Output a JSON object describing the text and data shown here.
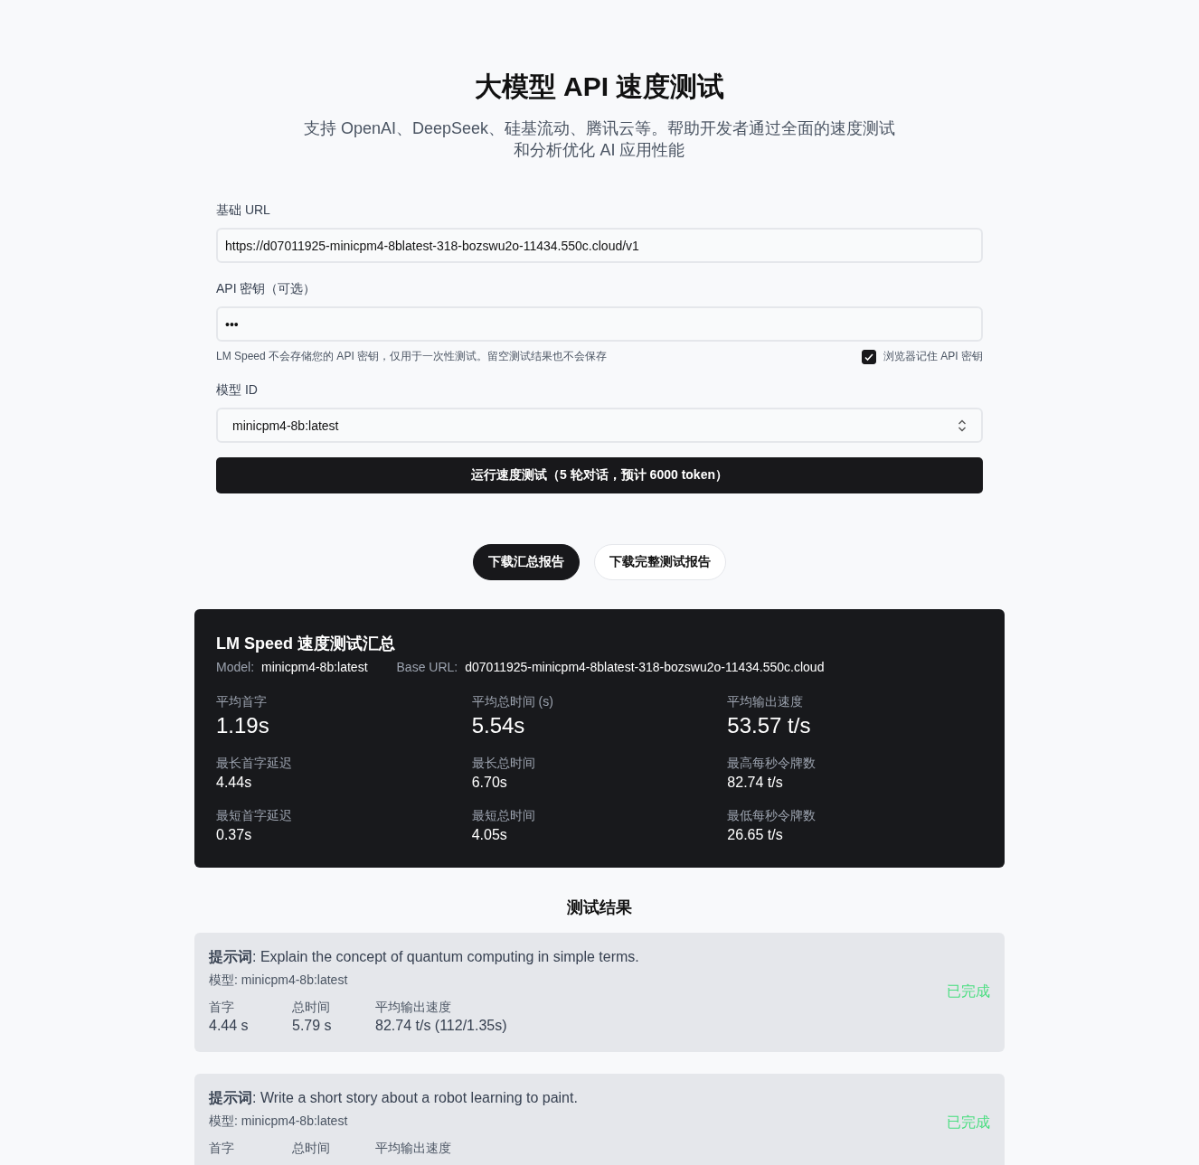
{
  "header": {
    "title": "大模型 API 速度测试",
    "subtitle_lines": [
      "支持 OpenAI、DeepSeek、硅基流动、腾讯云等。帮助开发者通过全面的速度测试",
      "和分析优化 AI 应用性能"
    ]
  },
  "form": {
    "base_url": {
      "label": "基础 URL",
      "value": "https://d07011925-minicpm4-8blatest-318-bozswu2o-11434.550c.cloud/v1"
    },
    "api_key": {
      "label": "API 密钥（可选）",
      "value": "•••",
      "hint": "LM Speed 不会存储您的 API 密钥，仅用于一次性测试。留空测试结果也不会保存",
      "remember": {
        "label": "浏览器记住 API 密钥",
        "checked": true
      }
    },
    "model": {
      "label": "模型 ID",
      "value": "minicpm4-8b:latest"
    },
    "run_button": "运行速度测试（5 轮对话，预计 6000 token）"
  },
  "downloads": [
    {
      "label": "下载汇总报告",
      "selected": true
    },
    {
      "label": "下载完整测试报告",
      "selected": false
    }
  ],
  "summary": {
    "title": "LM Speed 速度测试汇总",
    "meta": [
      {
        "label": "Model:",
        "value": "minicpm4-8b:latest"
      },
      {
        "label": "Base URL:",
        "value": "d07011925-minicpm4-8blatest-318-bozswu2o-11434.550c.cloud"
      }
    ],
    "stats": [
      {
        "label": "平均首字",
        "value": "1.19s",
        "kind": "main"
      },
      {
        "label": "平均总时间 (s)",
        "value": "5.54s",
        "kind": "main"
      },
      {
        "label": "平均输出速度",
        "value": "53.57 t/s",
        "kind": "main"
      },
      {
        "label": "最长首字延迟",
        "value": "4.44s",
        "kind": "minor"
      },
      {
        "label": "最长总时间",
        "value": "6.70s",
        "kind": "minor"
      },
      {
        "label": "最高每秒令牌数",
        "value": "82.74 t/s",
        "kind": "minor"
      },
      {
        "label": "最短首字延迟",
        "value": "0.37s",
        "kind": "minor"
      },
      {
        "label": "最短总时间",
        "value": "4.05s",
        "kind": "minor"
      },
      {
        "label": "最低每秒令牌数",
        "value": "26.65 t/s",
        "kind": "minor"
      }
    ]
  },
  "results": {
    "title": "测试结果",
    "items": [
      {
        "prompt": "**提示词**: Explain the concept of quantum computing in simple terms.",
        "model": "模型: minicpm4-8b:latest",
        "status_label": "已完成",
        "metrics": [
          {
            "label": "首字",
            "value": "4.44 s"
          },
          {
            "label": "总时间",
            "value": "5.79 s"
          },
          {
            "label": "平均输出速度",
            "value": "82.74 t/s (112/1.35s)"
          }
        ]
      },
      {
        "prompt": "**提示词**: Write a short story about a robot learning to paint.",
        "model": "模型: minicpm4-8b:latest",
        "status_label": "已完成",
        "metrics": [
          {
            "label": "首字"
          },
          {
            "label": "总时间"
          },
          {
            "label": "平均输出速度"
          }
        ]
      }
    ]
  }
}
